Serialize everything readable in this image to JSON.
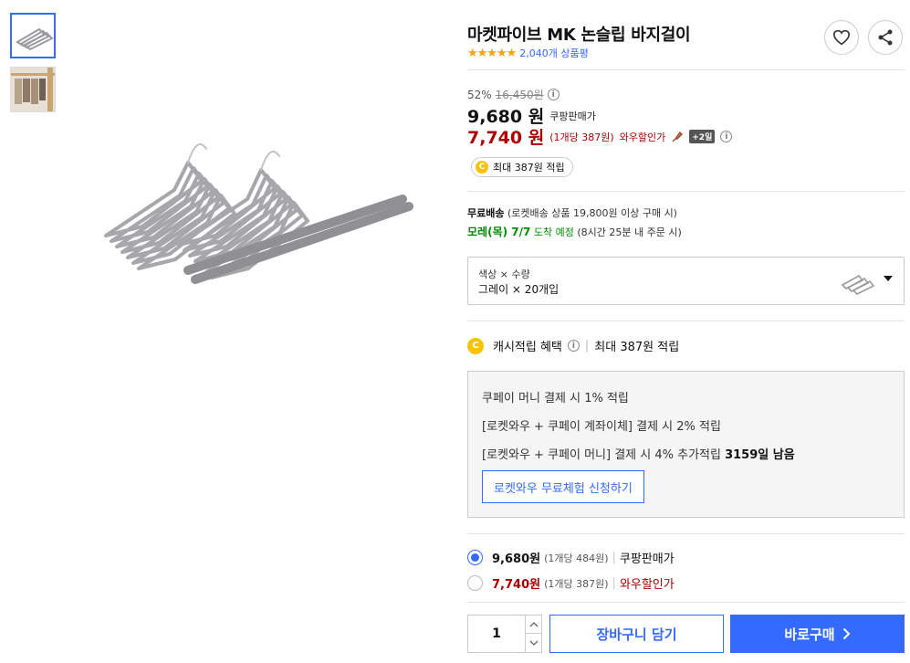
{
  "product": {
    "title": "마켓파이브 MK 논슬립 바지걸이",
    "rating_stars": "★★★★★",
    "review_count": "2,040개 상품평"
  },
  "pricing": {
    "discount_rate": "52%",
    "original_price": "16,450원",
    "coupang_price": "9,680",
    "won": "원",
    "coupang_label": "쿠팡판매가",
    "wow_price": "7,740",
    "wow_unit": "(1개당 387원)",
    "wow_label": "와우할인가",
    "wow_badge": "+2일",
    "cash_coin": "C",
    "cash_text": "최대 387원 적립"
  },
  "shipping": {
    "free_label": "무료배송",
    "free_note": "(로켓배송 상품 19,800원 이상 구매 시)",
    "arrival_date": "모레(목) 7/7",
    "arrival_suffix": "도착 예정",
    "arrival_note": "(8시간 25분 내 주문 시)"
  },
  "option": {
    "label": "색상 × 수량",
    "value": "그레이 × 20개입"
  },
  "cash_benefit": {
    "title": "캐시적립 혜택",
    "max": "최대 387원 적립",
    "lines": [
      "쿠페이 머니 결제 시 1% 적립",
      "[로켓와우 + 쿠페이 계좌이체] 결제 시 2% 적립",
      "[로켓와우 + 쿠페이 머니] 결제 시 4% 추가적립"
    ],
    "days_left": "3159일 남음",
    "trial_button": "로켓와우 무료체험 신청하기"
  },
  "price_options": [
    {
      "price": "9,680원",
      "unit": "(1개당 484원)",
      "label": "쿠팡판매가",
      "selected": true
    },
    {
      "price": "7,740원",
      "unit": "(1개당 387원)",
      "label": "와우할인가",
      "selected": false
    }
  ],
  "purchase": {
    "quantity": "1",
    "cart_button": "장바구니 담기",
    "buy_button": "바로구매"
  },
  "colors": {
    "accent": "#346aff",
    "wow_red": "#ae0000",
    "green": "#008c00",
    "star": "#f6a200"
  }
}
